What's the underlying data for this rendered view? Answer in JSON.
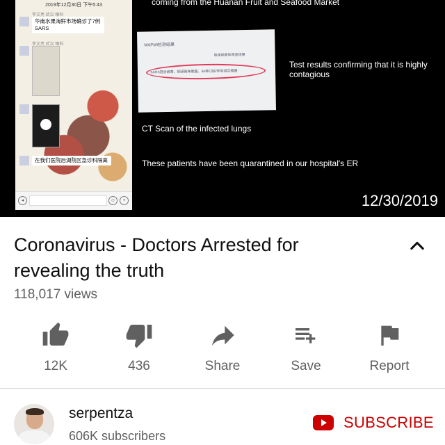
{
  "video": {
    "chat_date": "2019年12月30日 下午5:43",
    "chat_sender": "李文亮 武汉 眼科",
    "chat_msg1": "华南水果海鲜市场确诊了7例SARS",
    "chat_msg2": "在我们医院后湖院区急诊科隔离",
    "caption_top": "coming from the Huanan Fruit and Seafood Market",
    "report_header": "MAPMI检测结果",
    "report_line1": "临床病原体筛查结果",
    "report_line2": "SARS冠状病毒、铜绿假单胞菌、46种口腔/呼吸道定植菌",
    "caption_test": "Test results confirming that it is highly contagious",
    "caption_ct": "CT Scan of the infected lungs",
    "caption_quarantine": "These patients have been quarantined in our hospital's ER",
    "date_overlay": "12/30/2019"
  },
  "info": {
    "title": "Coronavirus - Doctors Arrested for revealing the truth",
    "views": "118,017 views",
    "collapse_icon": "chevron-up-icon"
  },
  "actions": {
    "like": {
      "count": "12K",
      "icon": "thumbs-up-icon"
    },
    "dislike": {
      "count": "436",
      "icon": "thumbs-down-icon"
    },
    "share": {
      "label": "Share",
      "icon": "share-icon"
    },
    "save": {
      "label": "Save",
      "icon": "playlist-add-icon"
    },
    "report": {
      "label": "Report",
      "icon": "flag-icon"
    }
  },
  "channel": {
    "name": "serpentza",
    "subscribers": "606K subscribers",
    "subscribe_label": "SUBSCRIBE",
    "subscribe_icon": "youtube-logo-icon"
  },
  "colors": {
    "accent": "#cc0000",
    "secondary_text": "#606060",
    "primary_text": "#0f0f0f"
  }
}
